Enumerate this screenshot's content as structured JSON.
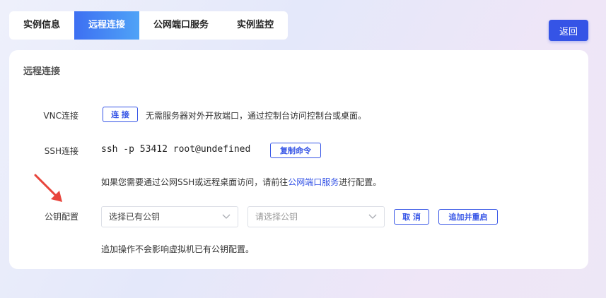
{
  "tabs": [
    {
      "label": "实例信息"
    },
    {
      "label": "远程连接"
    },
    {
      "label": "公网端口服务"
    },
    {
      "label": "实例监控"
    }
  ],
  "back_label": "返回",
  "card": {
    "title": "远程连接",
    "vnc": {
      "label": "VNC连接",
      "button": "连 接",
      "desc": "无需服务器对外开放端口，通过控制台访问控制台或桌面。"
    },
    "ssh": {
      "label": "SSH连接",
      "command": "ssh -p 53412 root@undefined",
      "copy_button": "复制命令",
      "hint_prefix": "如果您需要通过公网SSH或远程桌面访问，请前往",
      "hint_link": "公网端口服务",
      "hint_suffix": "进行配置。"
    },
    "key": {
      "label": "公钥配置",
      "select1_value": "选择已有公钥",
      "select2_placeholder": "请选择公钥",
      "cancel_button": "取 消",
      "add_button": "追加并重启",
      "note": "追加操作不会影响虚拟机已有公钥配置。"
    }
  },
  "colors": {
    "accent": "#3554e6",
    "annotation_arrow": "#e8453c"
  }
}
